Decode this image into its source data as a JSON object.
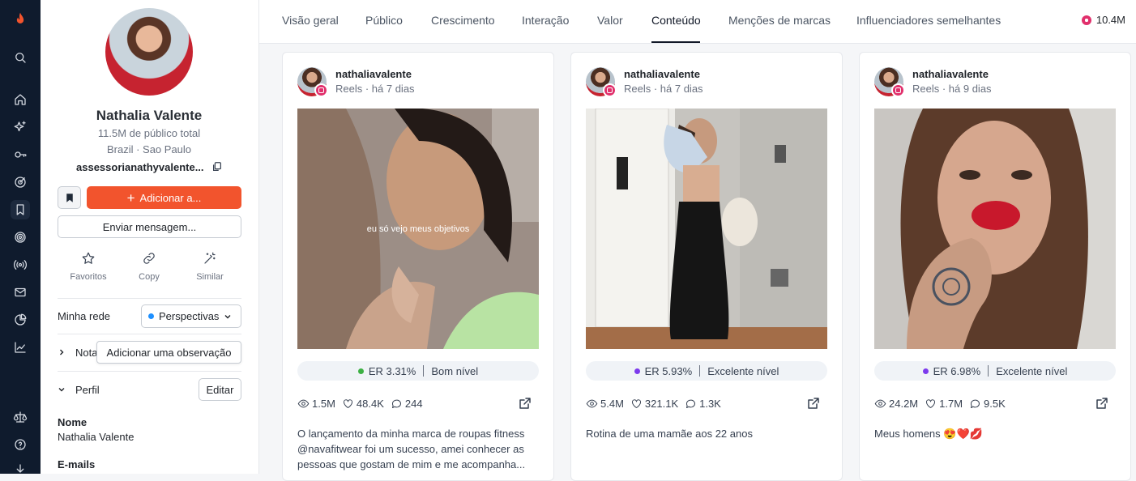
{
  "nav_rail": {
    "items": [
      "brand-logo-icon",
      "search-icon",
      "home-icon",
      "sparkles-icon",
      "key-icon",
      "target-icon",
      "bookmark-icon",
      "bullseye-icon",
      "broadcast-icon",
      "mail-icon",
      "pie-chart-icon",
      "trend-chart-icon",
      "scale-icon",
      "help-icon",
      "download-icon"
    ],
    "active": "bookmark-icon"
  },
  "profile": {
    "name": "Nathalia Valente",
    "audience": "11.5M de público total",
    "location": "Brazil · Sao Paulo",
    "handle": "assessorianathyvalente...",
    "add_label": "Adicionar a...",
    "message_label": "Enviar mensagem...",
    "actions": [
      {
        "label": "Favoritos",
        "icon": "star-icon"
      },
      {
        "label": "Copy",
        "icon": "link-icon"
      },
      {
        "label": "Similar",
        "icon": "magic-wand-icon"
      }
    ],
    "network_label": "Minha rede",
    "network_value": "Perspectivas",
    "notes_label": "Nota",
    "notes_tooltip": "Adicionar uma observação",
    "profile_section": "Perfil",
    "edit_label": "Editar",
    "name_label": "Nome",
    "name_value": "Nathalia Valente",
    "emails_label": "E-mails"
  },
  "tabs": [
    "Visão geral",
    "Público",
    "Crescimento",
    "Interação",
    "Valor",
    "Conteúdo",
    "Menções de marcas",
    "Influenciadores semelhantes"
  ],
  "active_tab": "Conteúdo",
  "reach": "10.4M",
  "posts": [
    {
      "user": "nathaliavalente",
      "meta": "Reels · há 7 dias",
      "overlay_text": "eu só vejo meus objetivos",
      "er": "ER 3.31%",
      "level": "Bom nível",
      "level_color": "#3cb043",
      "views": "1.5M",
      "likes": "48.4K",
      "comments": "244",
      "caption": "O lançamento da minha marca de roupas fitness @navafitwear foi um sucesso, amei conhecer as pessoas que gostam de mim e me acompanha..."
    },
    {
      "user": "nathaliavalente",
      "meta": "Reels · há 7 dias",
      "overlay_text": "",
      "er": "ER 5.93%",
      "level": "Excelente nível",
      "level_color": "#7c3aed",
      "views": "5.4M",
      "likes": "321.1K",
      "comments": "1.3K",
      "caption": "Rotina de uma mamãe aos 22 anos"
    },
    {
      "user": "nathaliavalente",
      "meta": "Reels · há 9 dias",
      "overlay_text": "",
      "er": "ER 6.98%",
      "level": "Excelente nível",
      "level_color": "#7c3aed",
      "views": "24.2M",
      "likes": "1.7M",
      "comments": "9.5K",
      "caption": "Meus homens 😍❤️💋"
    }
  ],
  "colors": {
    "rail_bg": "#0f1b2d",
    "accent": "#f2542d",
    "instagram": "#e1306c",
    "perspectivas_dot": "#1e90ff"
  }
}
